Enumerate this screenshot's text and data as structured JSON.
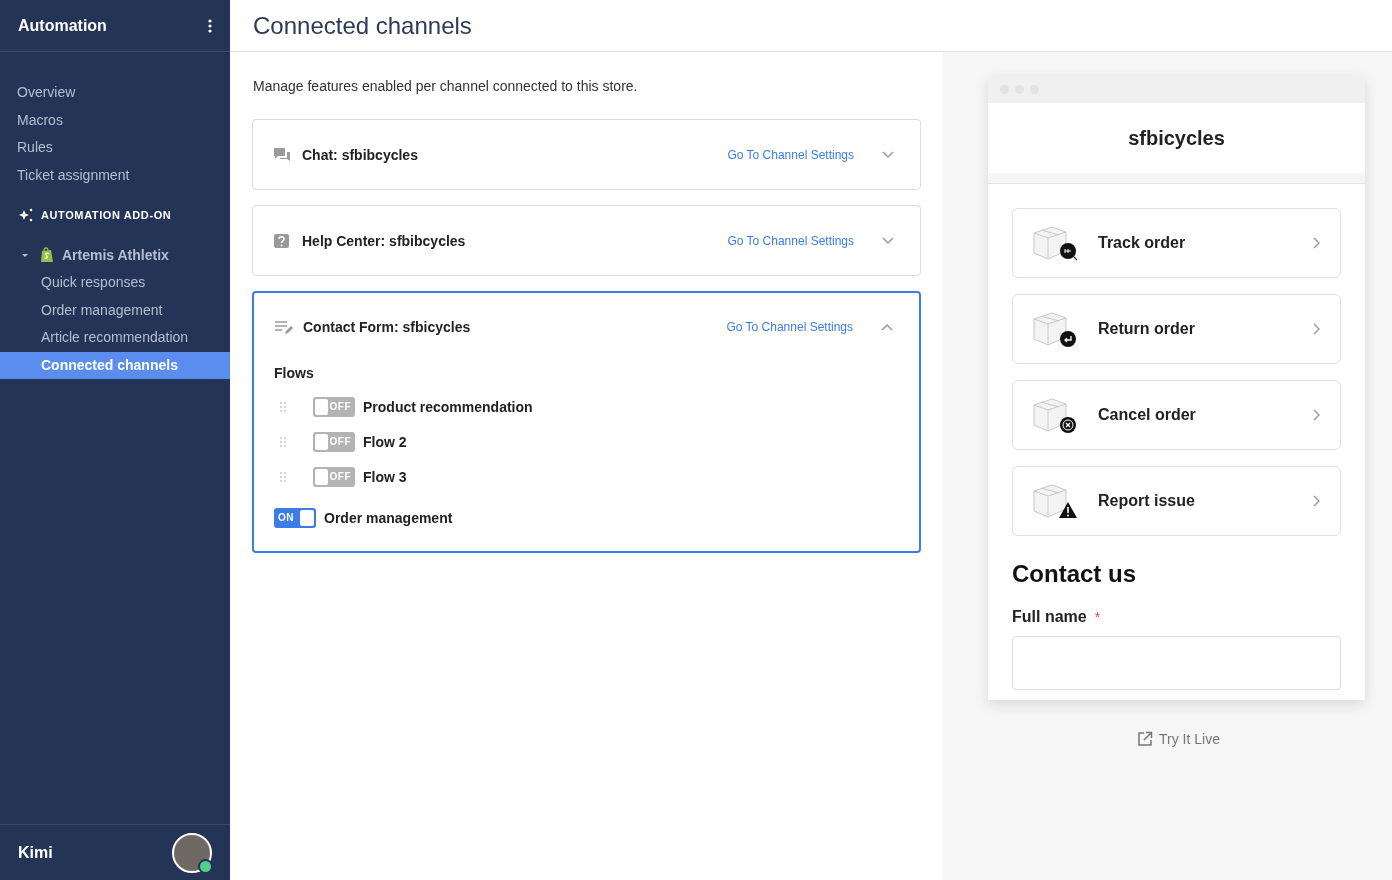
{
  "sidebar": {
    "title": "Automation",
    "items": [
      {
        "label": "Overview",
        "selected": false
      },
      {
        "label": "Macros",
        "selected": false
      },
      {
        "label": "Rules",
        "selected": false
      },
      {
        "label": "Ticket assignment",
        "selected": false
      }
    ],
    "section": "AUTOMATION ADD-ON",
    "store": {
      "name": "Artemis Athletix",
      "expanded": true,
      "items": [
        {
          "label": "Quick responses",
          "selected": false
        },
        {
          "label": "Order management",
          "selected": false
        },
        {
          "label": "Article recommendation",
          "selected": false
        },
        {
          "label": "Connected channels",
          "selected": true
        }
      ]
    },
    "user": {
      "name": "Kimi"
    }
  },
  "main": {
    "title": "Connected channels",
    "description": "Manage features enabled per channel connected to this store.",
    "channels": [
      {
        "kind": "chat",
        "title": "Chat: sfbibcycles",
        "link": "Go To Channel Settings",
        "expanded": false
      },
      {
        "kind": "help_center",
        "title": "Help Center: sfbibcycles",
        "link": "Go To Channel Settings",
        "expanded": false
      },
      {
        "kind": "contact_form",
        "title": "Contact Form: sfbicycles",
        "link": "Go To Channel Settings",
        "expanded": true,
        "flows": {
          "heading": "Flows",
          "items": [
            {
              "label": "Product recommendation",
              "on": false,
              "switch_text": "OFF"
            },
            {
              "label": "Flow 2",
              "on": false,
              "switch_text": "OFF"
            },
            {
              "label": "Flow 3",
              "on": false,
              "switch_text": "OFF"
            }
          ]
        },
        "toggles": [
          {
            "label": "Order management",
            "on": true,
            "switch_text": "ON"
          }
        ]
      }
    ]
  },
  "preview": {
    "store_name": "sfbicycles",
    "actions": [
      {
        "kind": "track",
        "label": "Track order"
      },
      {
        "kind": "return",
        "label": "Return order"
      },
      {
        "kind": "cancel",
        "label": "Cancel order"
      },
      {
        "kind": "report",
        "label": "Report issue"
      }
    ],
    "contact": {
      "heading": "Contact us",
      "field": {
        "label": "Full name",
        "required_mark": "*"
      }
    },
    "try_live": "Try It Live"
  }
}
